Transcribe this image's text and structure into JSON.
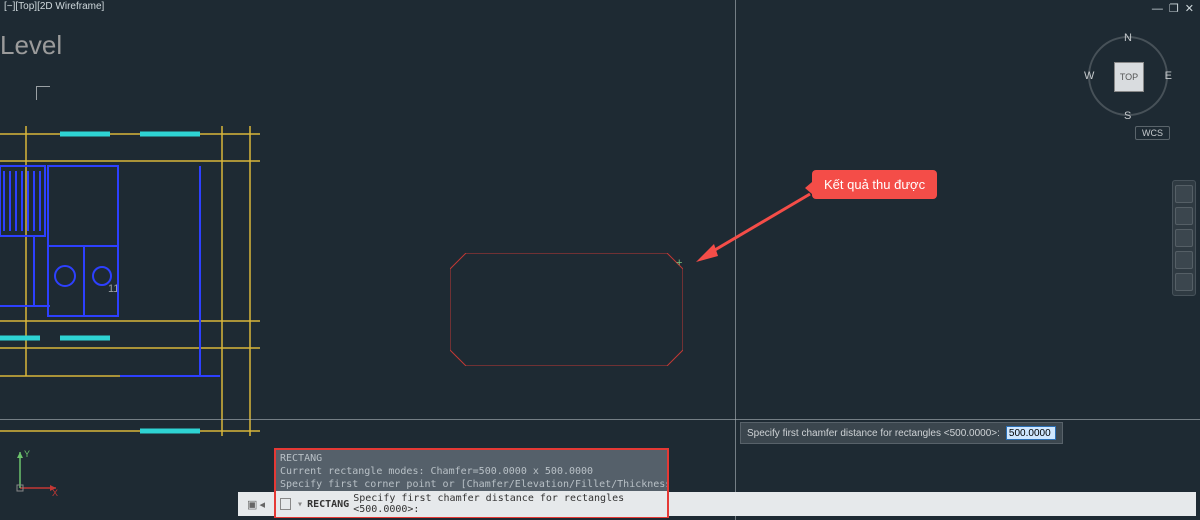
{
  "titlebar": {
    "label": "[−][Top][2D Wireframe]"
  },
  "window": {
    "min": "—",
    "restore": "❐",
    "close": "✕"
  },
  "watermark": {
    "text": "Level"
  },
  "viewcube": {
    "face": "TOP",
    "n": "N",
    "s": "S",
    "e": "E",
    "w": "W"
  },
  "wcs": {
    "label": "WCS"
  },
  "callout": {
    "text": "Kết quả thu được"
  },
  "tooltip": {
    "prompt": "Specify first chamfer distance for rectangles <500.0000>:",
    "value": "500.0000"
  },
  "cmd_history": {
    "l1": "RECTANG",
    "l2": "Current rectangle modes:  Chamfer=500.0000 x 500.0000",
    "l3": "Specify first corner point or [Chamfer/Elevation/Fillet/Thickness/Width]: c"
  },
  "cmdline": {
    "cmd": "RECTANG",
    "prompt": "Specify first chamfer distance for rectangles <500.0000>:"
  },
  "gutter": {
    "a": "▣",
    "b": "◂"
  },
  "dim": {
    "label": "11"
  }
}
